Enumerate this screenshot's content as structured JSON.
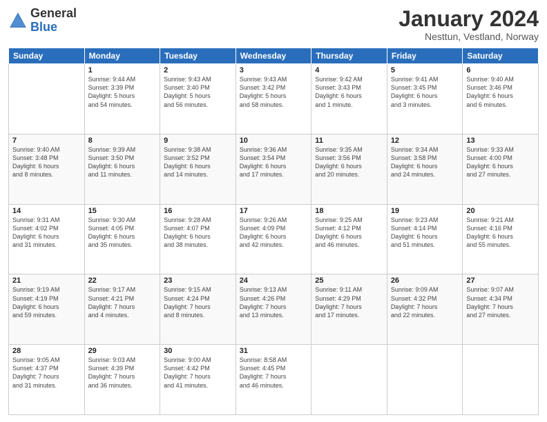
{
  "logo": {
    "general": "General",
    "blue": "Blue"
  },
  "header": {
    "month_title": "January 2024",
    "subtitle": "Nesttun, Vestland, Norway"
  },
  "days_of_week": [
    "Sunday",
    "Monday",
    "Tuesday",
    "Wednesday",
    "Thursday",
    "Friday",
    "Saturday"
  ],
  "weeks": [
    [
      {
        "day": "",
        "info": ""
      },
      {
        "day": "1",
        "info": "Sunrise: 9:44 AM\nSunset: 3:39 PM\nDaylight: 5 hours\nand 54 minutes."
      },
      {
        "day": "2",
        "info": "Sunrise: 9:43 AM\nSunset: 3:40 PM\nDaylight: 5 hours\nand 56 minutes."
      },
      {
        "day": "3",
        "info": "Sunrise: 9:43 AM\nSunset: 3:42 PM\nDaylight: 5 hours\nand 58 minutes."
      },
      {
        "day": "4",
        "info": "Sunrise: 9:42 AM\nSunset: 3:43 PM\nDaylight: 6 hours\nand 1 minute."
      },
      {
        "day": "5",
        "info": "Sunrise: 9:41 AM\nSunset: 3:45 PM\nDaylight: 6 hours\nand 3 minutes."
      },
      {
        "day": "6",
        "info": "Sunrise: 9:40 AM\nSunset: 3:46 PM\nDaylight: 6 hours\nand 6 minutes."
      }
    ],
    [
      {
        "day": "7",
        "info": "Sunrise: 9:40 AM\nSunset: 3:48 PM\nDaylight: 6 hours\nand 8 minutes."
      },
      {
        "day": "8",
        "info": "Sunrise: 9:39 AM\nSunset: 3:50 PM\nDaylight: 6 hours\nand 11 minutes."
      },
      {
        "day": "9",
        "info": "Sunrise: 9:38 AM\nSunset: 3:52 PM\nDaylight: 6 hours\nand 14 minutes."
      },
      {
        "day": "10",
        "info": "Sunrise: 9:36 AM\nSunset: 3:54 PM\nDaylight: 6 hours\nand 17 minutes."
      },
      {
        "day": "11",
        "info": "Sunrise: 9:35 AM\nSunset: 3:56 PM\nDaylight: 6 hours\nand 20 minutes."
      },
      {
        "day": "12",
        "info": "Sunrise: 9:34 AM\nSunset: 3:58 PM\nDaylight: 6 hours\nand 24 minutes."
      },
      {
        "day": "13",
        "info": "Sunrise: 9:33 AM\nSunset: 4:00 PM\nDaylight: 6 hours\nand 27 minutes."
      }
    ],
    [
      {
        "day": "14",
        "info": "Sunrise: 9:31 AM\nSunset: 4:02 PM\nDaylight: 6 hours\nand 31 minutes."
      },
      {
        "day": "15",
        "info": "Sunrise: 9:30 AM\nSunset: 4:05 PM\nDaylight: 6 hours\nand 35 minutes."
      },
      {
        "day": "16",
        "info": "Sunrise: 9:28 AM\nSunset: 4:07 PM\nDaylight: 6 hours\nand 38 minutes."
      },
      {
        "day": "17",
        "info": "Sunrise: 9:26 AM\nSunset: 4:09 PM\nDaylight: 6 hours\nand 42 minutes."
      },
      {
        "day": "18",
        "info": "Sunrise: 9:25 AM\nSunset: 4:12 PM\nDaylight: 6 hours\nand 46 minutes."
      },
      {
        "day": "19",
        "info": "Sunrise: 9:23 AM\nSunset: 4:14 PM\nDaylight: 6 hours\nand 51 minutes."
      },
      {
        "day": "20",
        "info": "Sunrise: 9:21 AM\nSunset: 4:16 PM\nDaylight: 6 hours\nand 55 minutes."
      }
    ],
    [
      {
        "day": "21",
        "info": "Sunrise: 9:19 AM\nSunset: 4:19 PM\nDaylight: 6 hours\nand 59 minutes."
      },
      {
        "day": "22",
        "info": "Sunrise: 9:17 AM\nSunset: 4:21 PM\nDaylight: 7 hours\nand 4 minutes."
      },
      {
        "day": "23",
        "info": "Sunrise: 9:15 AM\nSunset: 4:24 PM\nDaylight: 7 hours\nand 8 minutes."
      },
      {
        "day": "24",
        "info": "Sunrise: 9:13 AM\nSunset: 4:26 PM\nDaylight: 7 hours\nand 13 minutes."
      },
      {
        "day": "25",
        "info": "Sunrise: 9:11 AM\nSunset: 4:29 PM\nDaylight: 7 hours\nand 17 minutes."
      },
      {
        "day": "26",
        "info": "Sunrise: 9:09 AM\nSunset: 4:32 PM\nDaylight: 7 hours\nand 22 minutes."
      },
      {
        "day": "27",
        "info": "Sunrise: 9:07 AM\nSunset: 4:34 PM\nDaylight: 7 hours\nand 27 minutes."
      }
    ],
    [
      {
        "day": "28",
        "info": "Sunrise: 9:05 AM\nSunset: 4:37 PM\nDaylight: 7 hours\nand 31 minutes."
      },
      {
        "day": "29",
        "info": "Sunrise: 9:03 AM\nSunset: 4:39 PM\nDaylight: 7 hours\nand 36 minutes."
      },
      {
        "day": "30",
        "info": "Sunrise: 9:00 AM\nSunset: 4:42 PM\nDaylight: 7 hours\nand 41 minutes."
      },
      {
        "day": "31",
        "info": "Sunrise: 8:58 AM\nSunset: 4:45 PM\nDaylight: 7 hours\nand 46 minutes."
      },
      {
        "day": "",
        "info": ""
      },
      {
        "day": "",
        "info": ""
      },
      {
        "day": "",
        "info": ""
      }
    ]
  ]
}
